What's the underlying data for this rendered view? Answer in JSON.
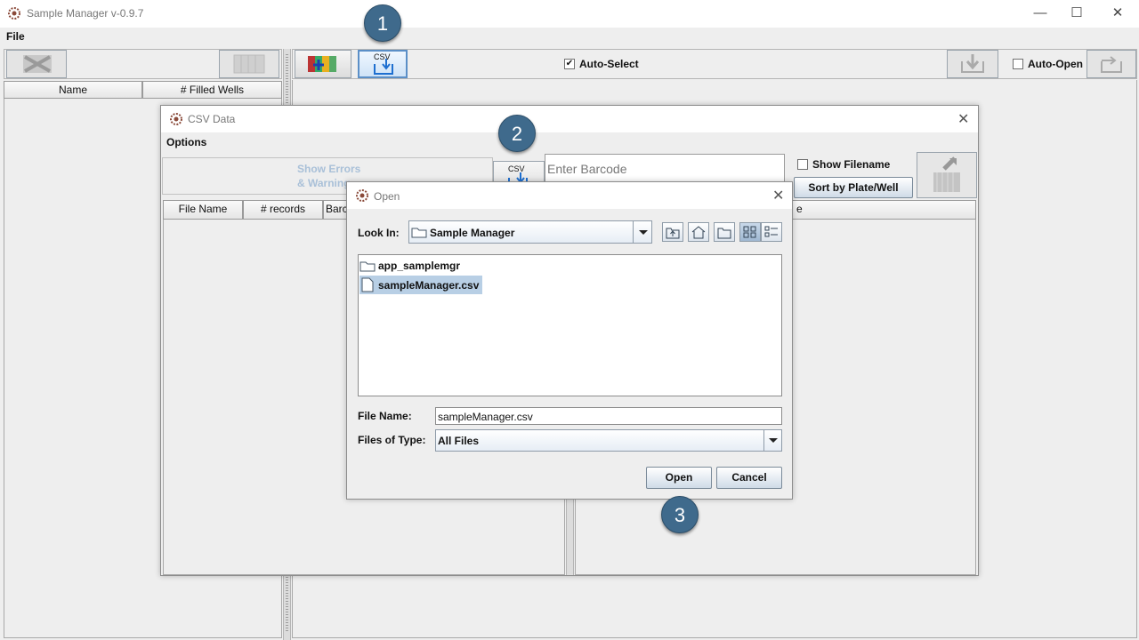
{
  "app": {
    "title": "Sample Manager v-0.9.7",
    "menu": [
      "File"
    ],
    "window_controls": {
      "minimize": "—",
      "maximize": "☐",
      "close": "✕"
    }
  },
  "left_panel": {
    "columns": [
      "Name",
      "# Filled Wells"
    ]
  },
  "toolbar": {
    "csv_label": "CSV",
    "auto_select_label": "Auto-Select",
    "auto_select_checked": true,
    "auto_open_label": "Auto-Open",
    "auto_open_checked": false
  },
  "csv_dialog": {
    "title": "CSV Data",
    "menu": "Options",
    "show_errors_label_line1": "Show Errors",
    "show_errors_label_line2": "& Warning",
    "csv_label": "CSV",
    "barcode_placeholder": "Enter Barcode",
    "show_filename_label": "Show Filename",
    "sort_label": "Sort by Plate/Well",
    "columns": [
      "File Name",
      "# records",
      "Barc"
    ],
    "right_column_partial": "e"
  },
  "open_dialog": {
    "title": "Open",
    "look_in_label": "Look In:",
    "look_in_value": "Sample Manager",
    "files": [
      {
        "name": "app_samplemgr",
        "type": "folder-icon",
        "selected": false
      },
      {
        "name": "sampleManager.csv",
        "type": "file-icon",
        "selected": true
      }
    ],
    "file_name_label": "File Name:",
    "file_name_value": "sampleManager.csv",
    "files_of_type_label": "Files of Type:",
    "files_of_type_value": "All Files",
    "open_button": "Open",
    "cancel_button": "Cancel"
  },
  "step_badges": [
    "1",
    "2",
    "3"
  ],
  "colors": {
    "badge": "#3f6a8c",
    "selection": "#b8cfe5",
    "accent_blue": "#1e6fd0"
  }
}
